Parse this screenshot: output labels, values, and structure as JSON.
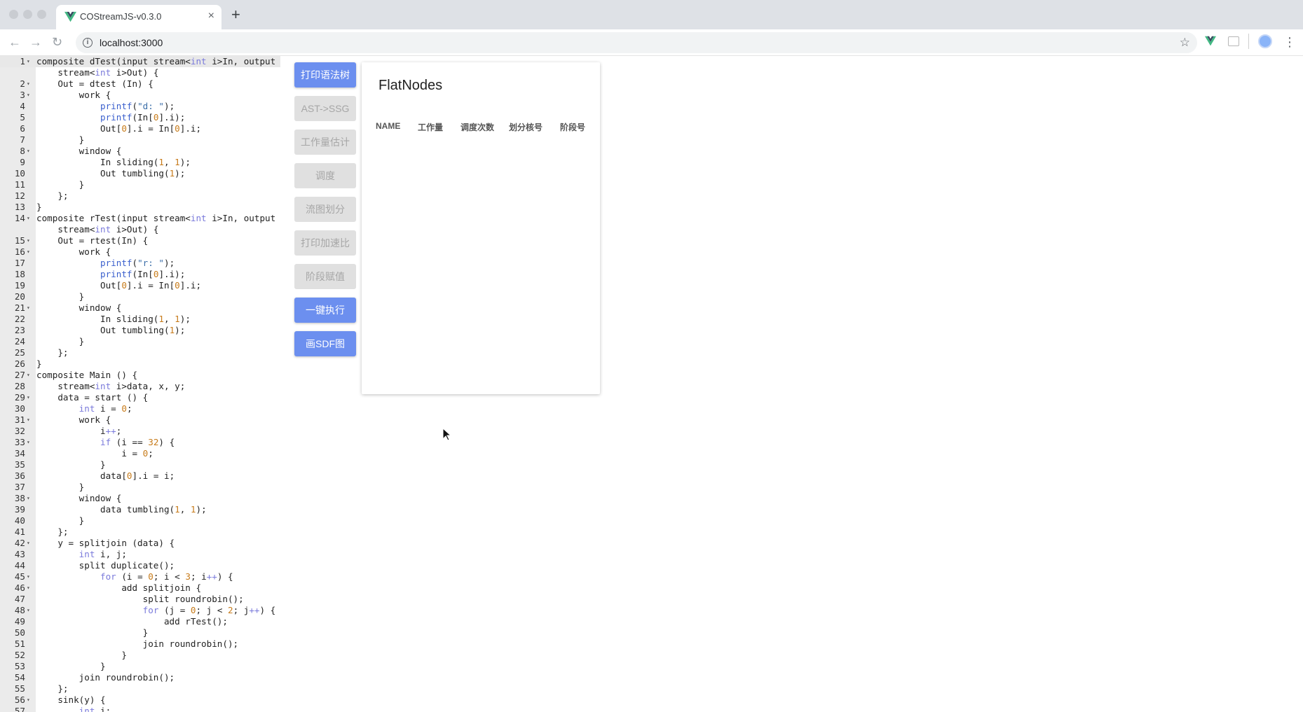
{
  "browser": {
    "tab_title": "COStreamJS-v0.3.0",
    "tab_close": "×",
    "new_tab": "+",
    "url": "localhost:3000"
  },
  "editor": {
    "lines": [
      {
        "n": "1",
        "fold": true,
        "active": true,
        "text": "composite dTest(input stream<int i>In, output"
      },
      {
        "n": "",
        "fold": false,
        "text": "    stream<int i>Out) {"
      },
      {
        "n": "2",
        "fold": true,
        "text": "    Out = dtest (In) {"
      },
      {
        "n": "3",
        "fold": true,
        "text": "        work {"
      },
      {
        "n": "4",
        "fold": false,
        "text": "            printf(\"d: \");"
      },
      {
        "n": "5",
        "fold": false,
        "text": "            printf(In[0].i);"
      },
      {
        "n": "6",
        "fold": false,
        "text": "            Out[0].i = In[0].i;"
      },
      {
        "n": "7",
        "fold": false,
        "text": "        }"
      },
      {
        "n": "8",
        "fold": true,
        "text": "        window {"
      },
      {
        "n": "9",
        "fold": false,
        "text": "            In sliding(1, 1);"
      },
      {
        "n": "10",
        "fold": false,
        "text": "            Out tumbling(1);"
      },
      {
        "n": "11",
        "fold": false,
        "text": "        }"
      },
      {
        "n": "12",
        "fold": false,
        "text": "    };"
      },
      {
        "n": "13",
        "fold": false,
        "text": "}"
      },
      {
        "n": "14",
        "fold": true,
        "text": "composite rTest(input stream<int i>In, output"
      },
      {
        "n": "",
        "fold": false,
        "text": "    stream<int i>Out) {"
      },
      {
        "n": "15",
        "fold": true,
        "text": "    Out = rtest(In) {"
      },
      {
        "n": "16",
        "fold": true,
        "text": "        work {"
      },
      {
        "n": "17",
        "fold": false,
        "text": "            printf(\"r: \");"
      },
      {
        "n": "18",
        "fold": false,
        "text": "            printf(In[0].i);"
      },
      {
        "n": "19",
        "fold": false,
        "text": "            Out[0].i = In[0].i;"
      },
      {
        "n": "20",
        "fold": false,
        "text": "        }"
      },
      {
        "n": "21",
        "fold": true,
        "text": "        window {"
      },
      {
        "n": "22",
        "fold": false,
        "text": "            In sliding(1, 1);"
      },
      {
        "n": "23",
        "fold": false,
        "text": "            Out tumbling(1);"
      },
      {
        "n": "24",
        "fold": false,
        "text": "        }"
      },
      {
        "n": "25",
        "fold": false,
        "text": "    };"
      },
      {
        "n": "26",
        "fold": false,
        "text": "}"
      },
      {
        "n": "27",
        "fold": true,
        "text": "composite Main () {"
      },
      {
        "n": "28",
        "fold": false,
        "text": "    stream<int i>data, x, y;"
      },
      {
        "n": "29",
        "fold": true,
        "text": "    data = start () {"
      },
      {
        "n": "30",
        "fold": false,
        "text": "        int i = 0;"
      },
      {
        "n": "31",
        "fold": true,
        "text": "        work {"
      },
      {
        "n": "32",
        "fold": false,
        "text": "            i++;"
      },
      {
        "n": "33",
        "fold": true,
        "text": "            if (i == 32) {"
      },
      {
        "n": "34",
        "fold": false,
        "text": "                i = 0;"
      },
      {
        "n": "35",
        "fold": false,
        "text": "            }"
      },
      {
        "n": "36",
        "fold": false,
        "text": "            data[0].i = i;"
      },
      {
        "n": "37",
        "fold": false,
        "text": "        }"
      },
      {
        "n": "38",
        "fold": true,
        "text": "        window {"
      },
      {
        "n": "39",
        "fold": false,
        "text": "            data tumbling(1, 1);"
      },
      {
        "n": "40",
        "fold": false,
        "text": "        }"
      },
      {
        "n": "41",
        "fold": false,
        "text": "    };"
      },
      {
        "n": "42",
        "fold": true,
        "text": "    y = splitjoin (data) {"
      },
      {
        "n": "43",
        "fold": false,
        "text": "        int i, j;"
      },
      {
        "n": "44",
        "fold": false,
        "text": "        split duplicate();"
      },
      {
        "n": "45",
        "fold": true,
        "text": "            for (i = 0; i < 3; i++) {"
      },
      {
        "n": "46",
        "fold": true,
        "text": "                add splitjoin {"
      },
      {
        "n": "47",
        "fold": false,
        "text": "                    split roundrobin();"
      },
      {
        "n": "48",
        "fold": true,
        "text": "                    for (j = 0; j < 2; j++) {"
      },
      {
        "n": "49",
        "fold": false,
        "text": "                        add rTest();"
      },
      {
        "n": "50",
        "fold": false,
        "text": "                    }"
      },
      {
        "n": "51",
        "fold": false,
        "text": "                    join roundrobin();"
      },
      {
        "n": "52",
        "fold": false,
        "text": "                }"
      },
      {
        "n": "53",
        "fold": false,
        "text": "            }"
      },
      {
        "n": "54",
        "fold": false,
        "text": "        join roundrobin();"
      },
      {
        "n": "55",
        "fold": false,
        "text": "    };"
      },
      {
        "n": "56",
        "fold": true,
        "text": "    sink(y) {"
      },
      {
        "n": "57",
        "fold": false,
        "text": "        int i;"
      }
    ]
  },
  "buttons": [
    {
      "label": "打印语法树",
      "enabled": true
    },
    {
      "label": "AST->SSG",
      "enabled": false
    },
    {
      "label": "工作量估计",
      "enabled": false
    },
    {
      "label": "调度",
      "enabled": false
    },
    {
      "label": "流图划分",
      "enabled": false
    },
    {
      "label": "打印加速比",
      "enabled": false
    },
    {
      "label": "阶段赋值",
      "enabled": false
    },
    {
      "label": "一键执行",
      "enabled": true
    },
    {
      "label": "画SDF图",
      "enabled": true
    }
  ],
  "panel": {
    "title": "FlatNodes",
    "columns": [
      "NAME",
      "工作量",
      "调度次数",
      "划分核号",
      "阶段号"
    ]
  },
  "colors": {
    "primary": "#6c8fef",
    "disabled_bg": "#e0e0e0",
    "disabled_text": "#a6a6a6",
    "gutter": "#ebebeb"
  },
  "icons": {
    "favicon": "vue-logo-icon",
    "back": "back-arrow-icon",
    "forward": "forward-arrow-icon",
    "reload": "reload-icon",
    "info": "info-icon",
    "star": "bookmark-star-icon",
    "menu": "menu-dots-icon"
  }
}
